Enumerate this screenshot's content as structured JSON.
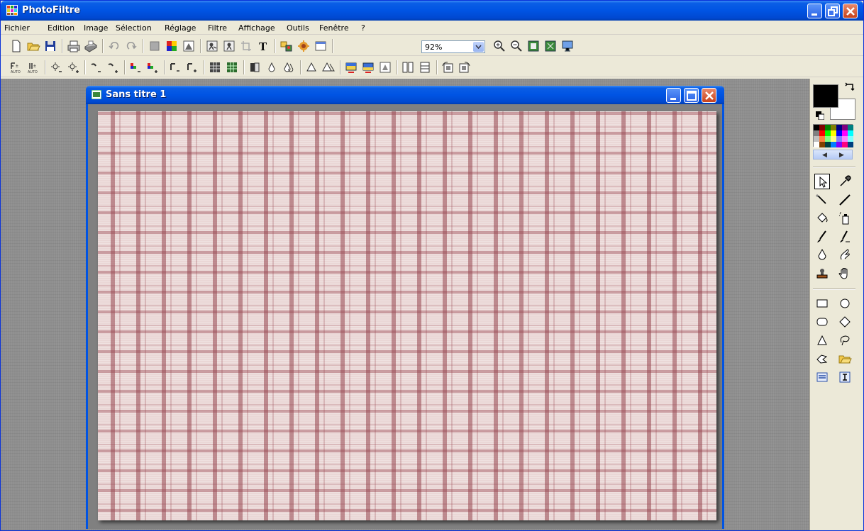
{
  "app": {
    "title": "PhotoFiltre"
  },
  "menu": [
    "Fichier",
    "Edition",
    "Image",
    "Sélection",
    "Réglage",
    "Filtre",
    "Affichage",
    "Outils",
    "Fenêtre",
    "?"
  ],
  "toolbar": {
    "zoom_value": "92%"
  },
  "document": {
    "title": "Sans titre 1"
  },
  "colors": {
    "foreground": "#000000",
    "background": "#ffffff",
    "titlebar": "#0054e3"
  }
}
